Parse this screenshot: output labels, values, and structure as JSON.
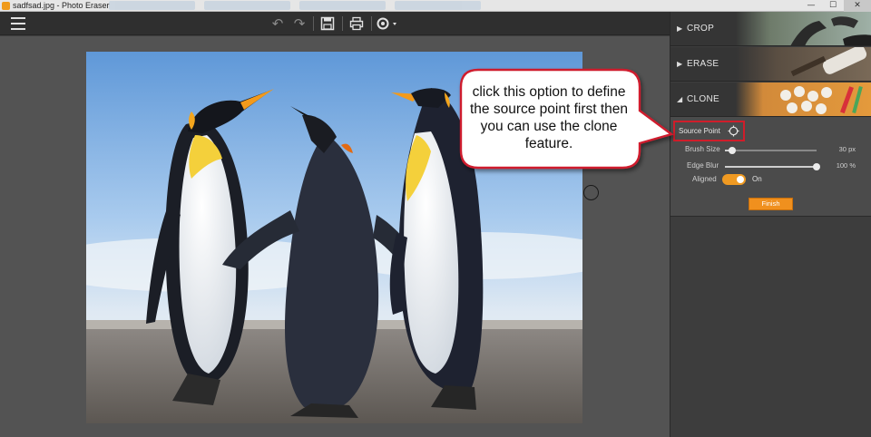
{
  "window": {
    "title": "sadfsad.jpg - Photo Eraser",
    "minimize_glyph": "—",
    "maximize_glyph": "☐",
    "close_glyph": "✕"
  },
  "toolbar": {
    "undo_glyph": "↶",
    "redo_glyph": "↷",
    "save_glyph": "💾",
    "print_glyph": "🖶",
    "settings_glyph": "⚙",
    "settings_caret": "▾"
  },
  "icons": {
    "menu": "menu-icon",
    "undo": "undo-icon",
    "redo": "redo-icon",
    "save": "save-icon",
    "print": "print-icon",
    "settings": "settings-icon",
    "source_point": "crosshair-icon"
  },
  "panel": {
    "sections": [
      {
        "label": "CROP",
        "arrow": "▶"
      },
      {
        "label": "ERASE",
        "arrow": "▶"
      },
      {
        "label": "CLONE",
        "arrow": "◢"
      }
    ],
    "clone": {
      "source_point_label": "Source Point",
      "brush_size_label": "Brush Size",
      "brush_size_value": "30 px",
      "brush_size_level": 0.08,
      "edge_blur_label": "Edge Blur",
      "edge_blur_value": "100 %",
      "edge_blur_level": 1.0,
      "aligned_label": "Aligned",
      "aligned_state": "On",
      "finish_label": "Finish"
    }
  },
  "callout": {
    "text": "click this option to define the source point first then you can use the clone feature."
  },
  "colors": {
    "accent": "#f09a22",
    "highlight_border": "#d01d2a",
    "panel_bg": "#3d3d3d",
    "canvas_bg": "#535353"
  }
}
